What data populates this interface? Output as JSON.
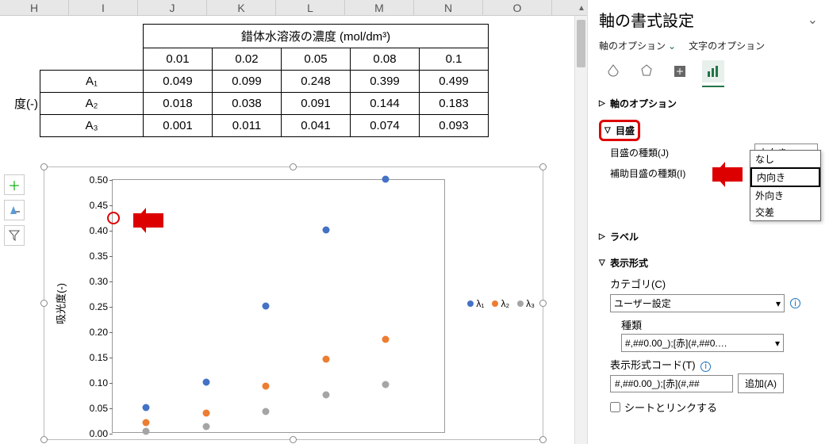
{
  "columns": [
    "H",
    "I",
    "J",
    "K",
    "L",
    "M",
    "N",
    "O"
  ],
  "table": {
    "merged_header": "錯体水溶液の濃度 (mol/dm³)",
    "row_label_outer": "度(-)",
    "col_vals": [
      "0.01",
      "0.02",
      "0.05",
      "0.08",
      "0.1"
    ],
    "rows": [
      {
        "label": "A₁",
        "vals": [
          "0.049",
          "0.099",
          "0.248",
          "0.399",
          "0.499"
        ]
      },
      {
        "label": "A₂",
        "vals": [
          "0.018",
          "0.038",
          "0.091",
          "0.144",
          "0.183"
        ]
      },
      {
        "label": "A₃",
        "vals": [
          "0.001",
          "0.011",
          "0.041",
          "0.074",
          "0.093"
        ]
      }
    ]
  },
  "chart": {
    "y_title": "吸光度(-)",
    "y_ticks": [
      "0.00",
      "0.05",
      "0.10",
      "0.15",
      "0.20",
      "0.25",
      "0.30",
      "0.35",
      "0.40",
      "0.45",
      "0.50"
    ],
    "ymax": 0.5,
    "legend": [
      "λ₁",
      "λ₂",
      "λ₃"
    ]
  },
  "chart_data": {
    "type": "scatter",
    "xlabel": "錯体水溶液の濃度 (mol/dm³)",
    "ylabel": "吸光度(-)",
    "ylim": [
      0,
      0.5
    ],
    "x": [
      0.01,
      0.02,
      0.05,
      0.08,
      0.1
    ],
    "series": [
      {
        "name": "λ₁",
        "values": [
          0.049,
          0.099,
          0.248,
          0.399,
          0.499
        ],
        "color": "#4472C4"
      },
      {
        "name": "λ₂",
        "values": [
          0.018,
          0.038,
          0.091,
          0.144,
          0.183
        ],
        "color": "#ED7D31"
      },
      {
        "name": "λ₃",
        "values": [
          0.001,
          0.011,
          0.041,
          0.074,
          0.093
        ],
        "color": "#A5A5A5"
      }
    ]
  },
  "panel": {
    "title": "軸の書式設定",
    "opt_axis": "軸のオプション",
    "opt_text": "文字のオプション",
    "sec_axis_opts": "軸のオプション",
    "sec_ticks": "目盛",
    "sec_label": "ラベル",
    "sec_format": "表示形式",
    "major_tick_label": "目盛の種類(J)",
    "major_tick_value": "内向き",
    "minor_tick_label": "補助目盛の種類(I)",
    "dd_items": [
      "なし",
      "内向き",
      "外向き",
      "交差"
    ],
    "category_label": "カテゴリ(C)",
    "category_value": "ユーザー設定",
    "type_label": "種類",
    "type_value": "#,##0.00_);[赤](#,##0.…",
    "code_label": "表示形式コード(T)",
    "code_value": "#,##0.00_);[赤](#,##",
    "add_btn": "追加(A)",
    "link_sheet": "シートとリンクする"
  }
}
